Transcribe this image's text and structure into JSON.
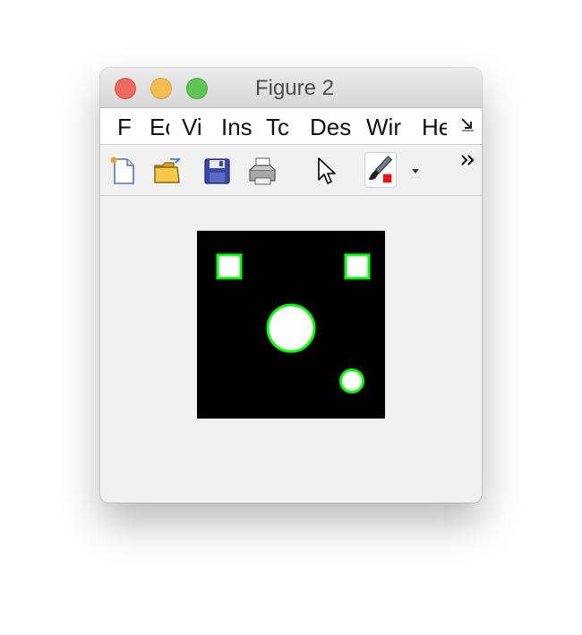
{
  "window": {
    "title": "Figure 2"
  },
  "menubar": {
    "items": [
      "F",
      "Ec",
      "Vi",
      "Ins",
      "Tc",
      "Des",
      "Wir",
      "He"
    ],
    "overflow_icon": "menu-overflow-arrow-icon"
  },
  "toolbar": {
    "buttons": [
      {
        "name": "new-figure-button",
        "icon": "new-document-icon"
      },
      {
        "name": "open-file-button",
        "icon": "folder-open-icon"
      },
      {
        "name": "save-button",
        "icon": "floppy-disk-icon"
      },
      {
        "name": "print-button",
        "icon": "printer-icon"
      },
      {
        "name": "pointer-button",
        "icon": "arrow-pointer-icon"
      },
      {
        "name": "brush-button",
        "icon": "paint-brush-icon"
      },
      {
        "name": "brush-dropdown-button",
        "icon": "triangle-down-icon"
      },
      {
        "name": "toolbar-overflow-button",
        "icon": "double-chevron-right-icon"
      }
    ]
  },
  "figure": {
    "image_background": "#000000",
    "object_fill": "#ffffff",
    "outline_color": "#00ff00",
    "objects": [
      {
        "shape": "square",
        "label": "top-left square"
      },
      {
        "shape": "square",
        "label": "top-right square"
      },
      {
        "shape": "circle",
        "label": "large circle"
      },
      {
        "shape": "circle",
        "label": "small circle"
      }
    ]
  }
}
